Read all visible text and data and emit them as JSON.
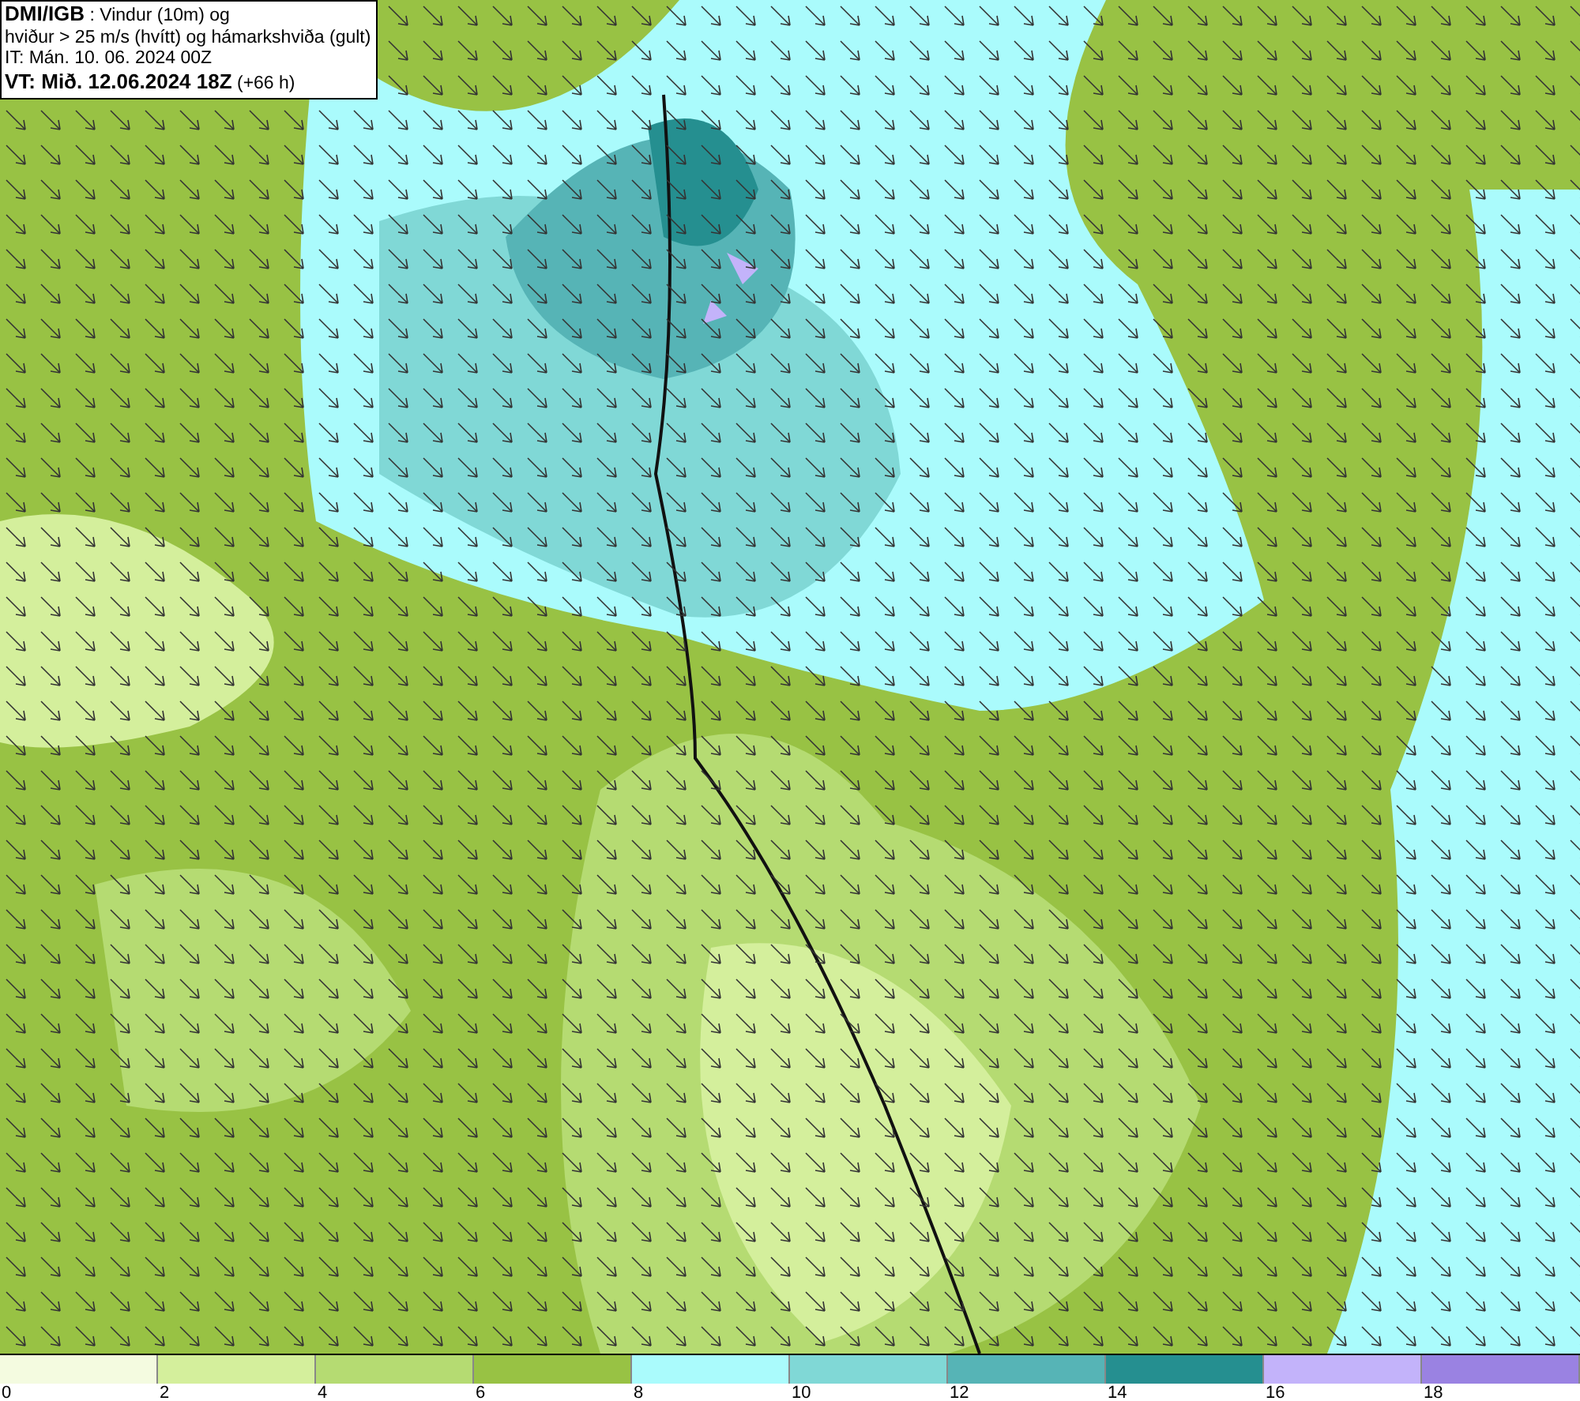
{
  "title_box": {
    "lines": [
      "**DMI/IGB** : Vindur (10m) og",
      "hviður > 25 m/s (hvítt) og hámarkshviða (gult)",
      "IT: Mán. 10. 06. 2024 00Z",
      "**VT: Mið. 12.06.2024 18Z** (+66 h)"
    ]
  },
  "legend": {
    "swatches": [
      {
        "color": "#f4fbe0"
      },
      {
        "color": "#d4ef9c"
      },
      {
        "color": "#b5db72"
      },
      {
        "color": "#98c244"
      },
      {
        "color": "#aafbfc"
      },
      {
        "color": "#80d8d6"
      },
      {
        "color": "#56b4b6"
      },
      {
        "color": "#258f90"
      },
      {
        "color": "#c3b3fa"
      },
      {
        "color": "#9a82e2"
      }
    ],
    "ticks": [
      "0",
      "2",
      "4",
      "6",
      "8",
      "10",
      "12",
      "14",
      "16",
      "18"
    ]
  }
}
